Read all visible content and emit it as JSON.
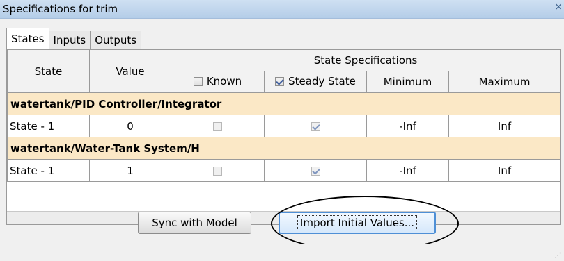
{
  "window": {
    "title": "Specifications for trim",
    "close_glyph": "×"
  },
  "tabs": [
    {
      "label": "States",
      "active": true
    },
    {
      "label": "Inputs",
      "active": false
    },
    {
      "label": "Outputs",
      "active": false
    }
  ],
  "table": {
    "headers": {
      "state": "State",
      "value": "Value",
      "group": "State Specifications",
      "known": "Known",
      "steady_state": "Steady State",
      "minimum": "Minimum",
      "maximum": "Maximum"
    },
    "header_checks": {
      "known": false,
      "steady_state": true
    },
    "groups": [
      {
        "name": "watertank/PID Controller/Integrator",
        "row": {
          "state": "State - 1",
          "value": "0",
          "known": false,
          "steady_state": true,
          "minimum": "-Inf",
          "maximum": "Inf"
        }
      },
      {
        "name": "watertank/Water-Tank System/H",
        "row": {
          "state": "State - 1",
          "value": "1",
          "known": false,
          "steady_state": true,
          "minimum": "-Inf",
          "maximum": "Inf"
        }
      }
    ]
  },
  "buttons": {
    "sync": "Sync with Model",
    "import": "Import Initial Values..."
  },
  "colors": {
    "group_row": "#fbe8c6",
    "import_border": "#4e8fd6",
    "titlebar": "#c4d8ee"
  },
  "icons": {
    "close": "close-icon",
    "resize": "resize-grip-icon"
  }
}
